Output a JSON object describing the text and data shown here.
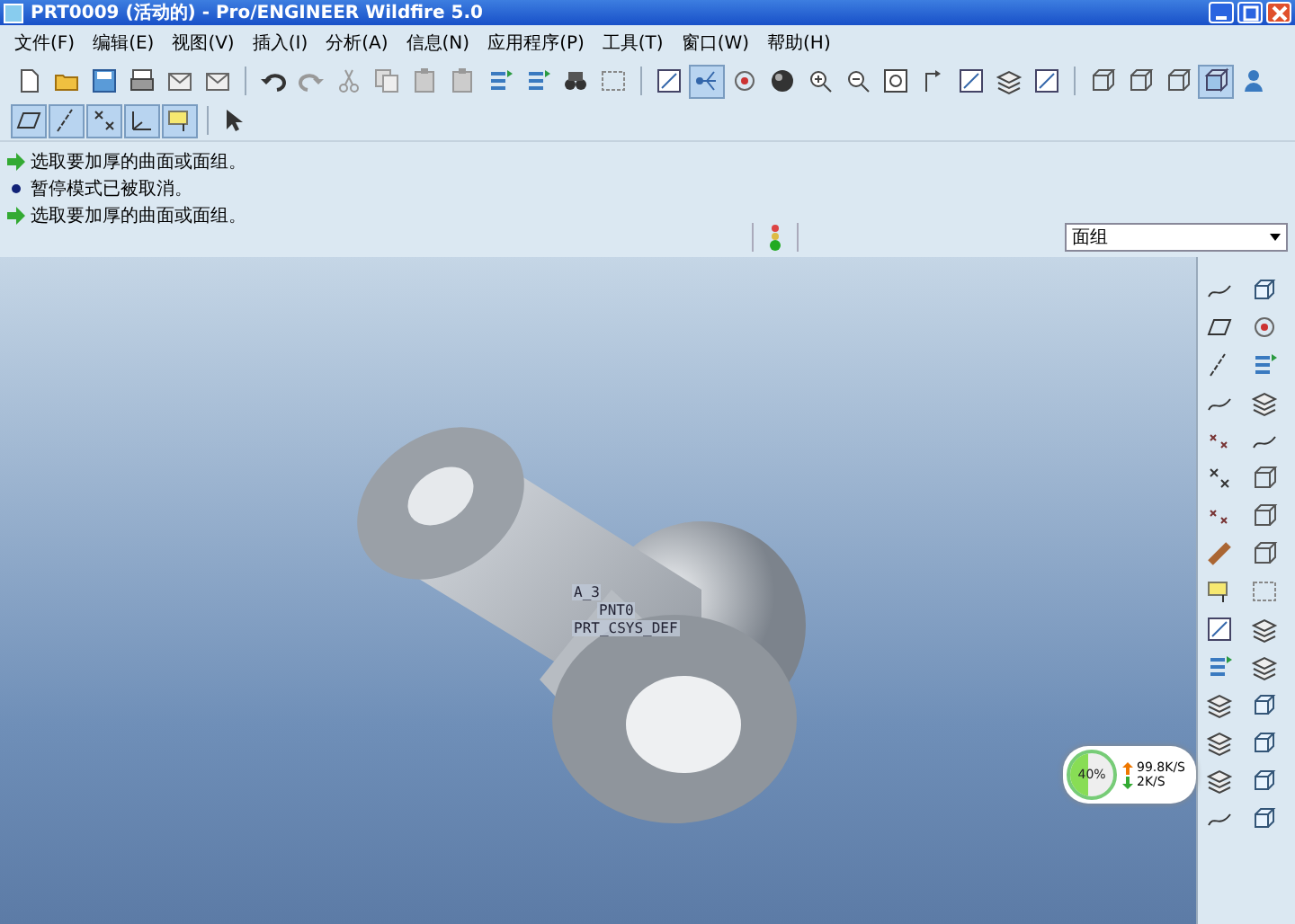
{
  "window": {
    "title": "PRT0009 (活动的) - Pro/ENGINEER Wildfire 5.0"
  },
  "menu": [
    "文件(F)",
    "编辑(E)",
    "视图(V)",
    "插入(I)",
    "分析(A)",
    "信息(N)",
    "应用程序(P)",
    "工具(T)",
    "窗口(W)",
    "帮助(H)"
  ],
  "toolbar_row1": [
    {
      "kind": "new-file",
      "on": false
    },
    {
      "kind": "folder",
      "on": false
    },
    {
      "kind": "save",
      "on": false
    },
    {
      "kind": "printer",
      "on": false
    },
    {
      "kind": "envelope",
      "on": false
    },
    {
      "kind": "envelope",
      "on": false
    },
    {
      "kind": "sep"
    },
    {
      "kind": "undo",
      "on": false
    },
    {
      "kind": "redo",
      "on": false
    },
    {
      "kind": "scissors",
      "on": false
    },
    {
      "kind": "copy",
      "on": false
    },
    {
      "kind": "paste",
      "on": false
    },
    {
      "kind": "paste",
      "on": false
    },
    {
      "kind": "regenerate",
      "on": false
    },
    {
      "kind": "regenerate",
      "on": false
    },
    {
      "kind": "binoculars",
      "on": false
    },
    {
      "kind": "select-box",
      "on": false
    },
    {
      "kind": "sep"
    },
    {
      "kind": "view",
      "on": false
    },
    {
      "kind": "node-link",
      "on": true
    },
    {
      "kind": "spin",
      "on": false
    },
    {
      "kind": "sphere",
      "on": false
    },
    {
      "kind": "zoom-in",
      "on": false
    },
    {
      "kind": "zoom-out",
      "on": false
    },
    {
      "kind": "zoom-fit",
      "on": false
    },
    {
      "kind": "reorient",
      "on": false
    },
    {
      "kind": "view",
      "on": false
    },
    {
      "kind": "layers",
      "on": false
    },
    {
      "kind": "view",
      "on": false
    },
    {
      "kind": "sep"
    },
    {
      "kind": "cube",
      "on": false
    },
    {
      "kind": "cube",
      "on": false
    },
    {
      "kind": "cube",
      "on": false
    },
    {
      "kind": "shaded-cube",
      "on": true
    },
    {
      "kind": "person",
      "on": false
    }
  ],
  "toolbar_row2": [
    {
      "kind": "plane",
      "on": true
    },
    {
      "kind": "axis",
      "on": true
    },
    {
      "kind": "point",
      "on": true
    },
    {
      "kind": "csys",
      "on": true
    },
    {
      "kind": "annotation",
      "on": true
    },
    {
      "kind": "sep"
    },
    {
      "kind": "help-cursor",
      "on": false
    }
  ],
  "messages": [
    {
      "kind": "prompt",
      "text": "选取要加厚的曲面或面组。"
    },
    {
      "kind": "info",
      "text": "暂停模式已被取消。"
    },
    {
      "kind": "prompt",
      "text": "选取要加厚的曲面或面组。"
    }
  ],
  "filter": {
    "value": "面组"
  },
  "datum_labels": [
    "A_3",
    "PNT0",
    "PRT_CSYS_DEF"
  ],
  "network_meter": {
    "percent": "40%",
    "level": 0.4,
    "upload": "99.8K/S",
    "download": "2K/S"
  }
}
